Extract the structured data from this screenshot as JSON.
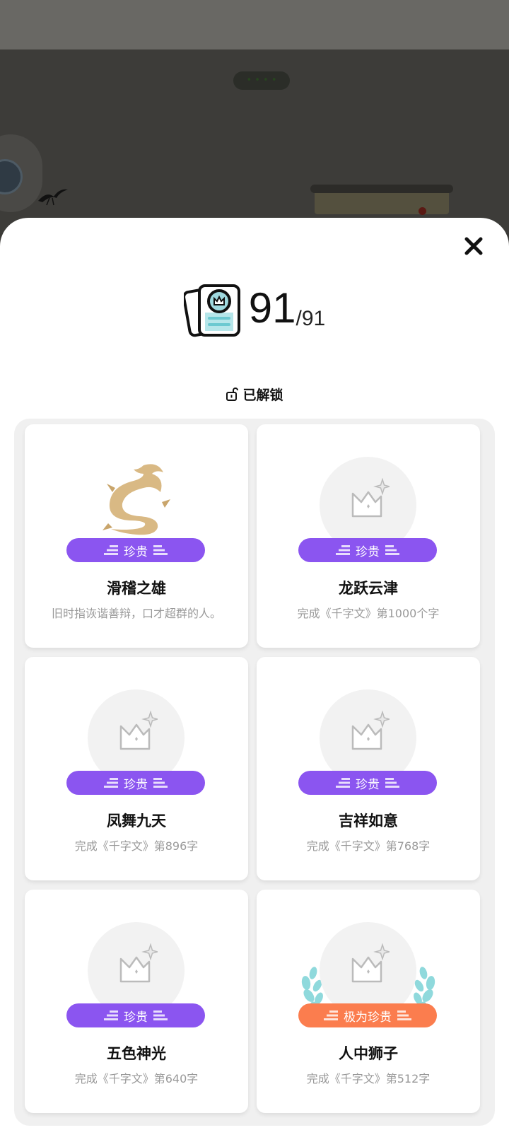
{
  "background": {
    "pill_text": "• • • •"
  },
  "header": {
    "unlocked_count": "91",
    "total_count": "/91",
    "close_icon": "close-icon"
  },
  "filter": {
    "label": "已解锁",
    "icon": "unlock-icon"
  },
  "colors": {
    "rare_badge": "#8b55f0",
    "very_rare_badge": "#fb7d4e",
    "panel": "#f0f0f0"
  },
  "achievements": [
    {
      "title": "滑稽之雄",
      "desc": "旧时指诙谐善辩，口才超群的人。",
      "badge": "珍贵",
      "emblem": "dragon"
    },
    {
      "title": "龙跃云津",
      "desc": "完成《千字文》第1000个字",
      "badge": "珍贵",
      "emblem": "crown"
    },
    {
      "title": "凤舞九天",
      "desc": "完成《千字文》第896字",
      "badge": "珍贵",
      "emblem": "crown"
    },
    {
      "title": "吉祥如意",
      "desc": "完成《千字文》第768字",
      "badge": "珍贵",
      "emblem": "crown"
    },
    {
      "title": "五色神光",
      "desc": "完成《千字文》第640字",
      "badge": "珍贵",
      "emblem": "crown"
    },
    {
      "title": "人中狮子",
      "desc": "完成《千字文》第512字",
      "badge": "极为珍贵",
      "emblem": "crown-laurel"
    }
  ]
}
